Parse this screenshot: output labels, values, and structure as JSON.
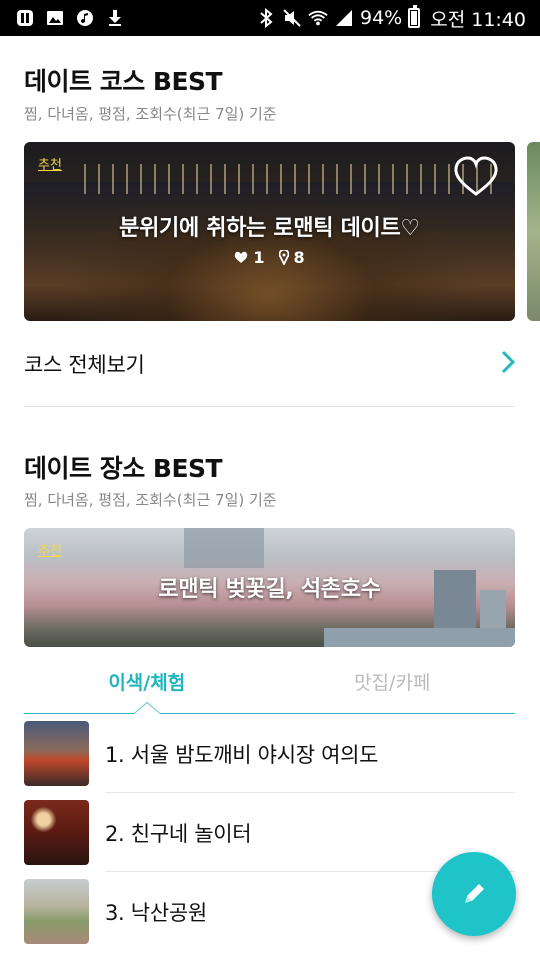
{
  "status_bar": {
    "battery": "94%",
    "clock": "오전 11:40",
    "icons_left": [
      "app-notification-icon",
      "gallery-icon",
      "music-icon",
      "download-icon"
    ],
    "icons_right": [
      "bluetooth-icon",
      "mute-icon",
      "wifi-icon",
      "signal-icon",
      "battery-icon"
    ]
  },
  "course_section": {
    "title": "데이트 코스 BEST",
    "subtitle": "찜, 다녀옴, 평점, 조회수(최근 7일) 기준",
    "card": {
      "badge": "추천",
      "title": "분위기에 취하는 로맨틱 데이트♡",
      "likes": "1",
      "places": "8"
    },
    "view_all_label": "코스 전체보기"
  },
  "place_section": {
    "title": "데이트 장소 BEST",
    "subtitle": "찜, 다녀옴, 평점, 조회수(최근 7일) 기준",
    "card": {
      "badge": "추천",
      "title": "로맨틱 벚꽃길, 석촌호수"
    },
    "tabs": [
      {
        "label": "이색/체험",
        "active": true
      },
      {
        "label": "맛집/카페",
        "active": false
      }
    ],
    "items": [
      {
        "label": "1. 서울 밤도깨비 야시장 여의도"
      },
      {
        "label": "2. 친구네 놀이터"
      },
      {
        "label": "3. 낙산공원"
      }
    ]
  },
  "colors": {
    "accent": "#1ec4c8",
    "badge": "#f4d84a"
  }
}
